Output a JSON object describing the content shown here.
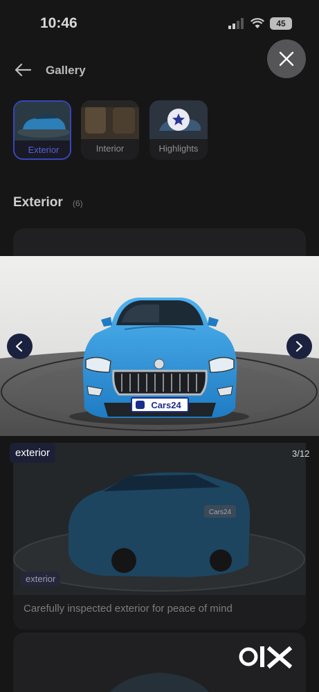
{
  "status_bar": {
    "time": "10:46",
    "battery": "45"
  },
  "header": {
    "title": "Gallery"
  },
  "tabs": [
    {
      "label": "Exterior",
      "active": true
    },
    {
      "label": "Interior",
      "active": false
    },
    {
      "label": "Highlights",
      "active": false
    }
  ],
  "section": {
    "title": "Exterior",
    "count": "(6)"
  },
  "viewer": {
    "tag": "exterior",
    "counter": "3/12",
    "plate_text": "Cars24"
  },
  "card2": {
    "tag": "exterior",
    "caption": "Carefully inspected exterior for peace of mind",
    "plate_text": "Cars24"
  },
  "watermark": "OLX",
  "icons": {
    "back": "arrow-left-icon",
    "close": "close-icon",
    "prev": "chevron-left-icon",
    "next": "chevron-right-icon",
    "highlights": "star-icon"
  },
  "colors": {
    "accent": "#3946b8",
    "nav": "#1b2240",
    "car": "#2a8fd6"
  }
}
